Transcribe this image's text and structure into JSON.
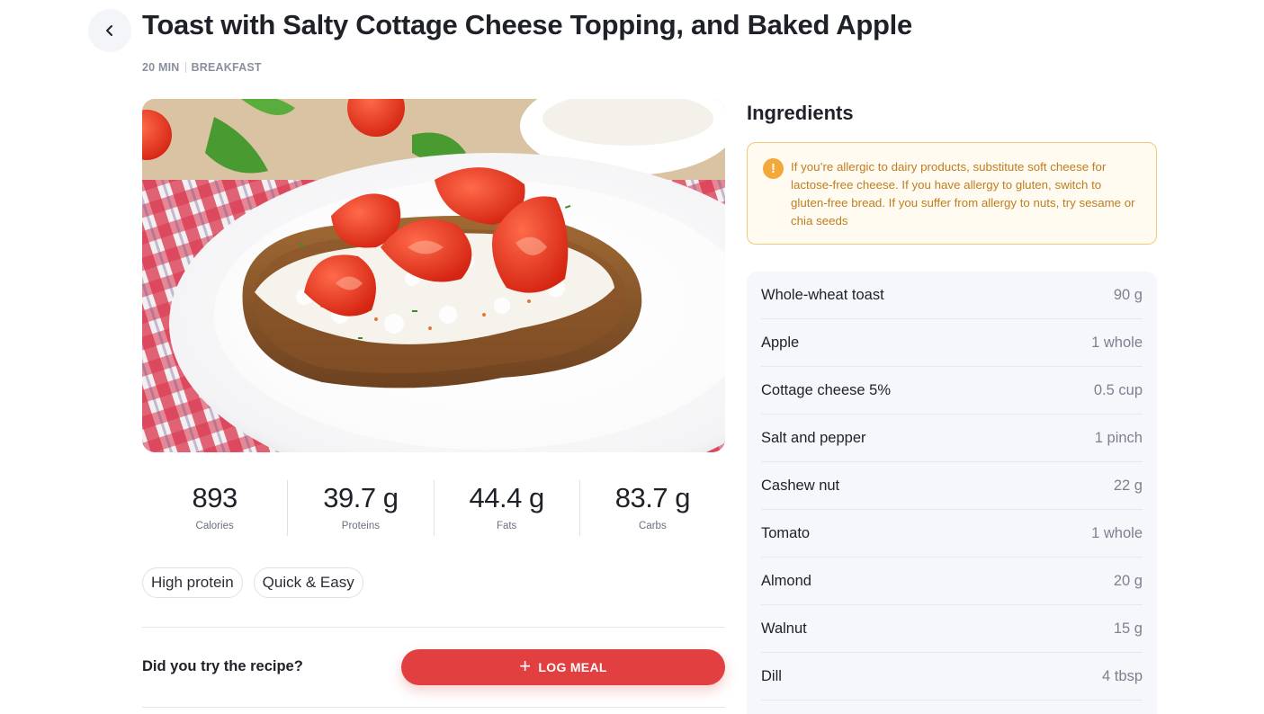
{
  "header": {
    "title": "Toast with Salty Cottage Cheese Topping, and Baked Apple",
    "duration": "20 MIN",
    "meal_type": "BREAKFAST"
  },
  "nutrition": [
    {
      "value": "893",
      "label": "Calories"
    },
    {
      "value": "39.7 g",
      "label": "Proteins"
    },
    {
      "value": "44.4 g",
      "label": "Fats"
    },
    {
      "value": "83.7 g",
      "label": "Carbs"
    }
  ],
  "tags": [
    "High protein",
    "Quick & Easy"
  ],
  "cta": {
    "question": "Did you try the recipe?",
    "log_meal_label": "LOG MEAL"
  },
  "ingredients": {
    "title": "Ingredients",
    "allergy_note": "If you’re allergic to dairy products, substitute soft cheese for lactose-free cheese. If you have allergy to gluten, switch to gluten-free bread. If you suffer from allergy to nuts, try sesame or chia seeds",
    "items": [
      {
        "name": "Whole-wheat toast",
        "qty": "90 g"
      },
      {
        "name": "Apple",
        "qty": "1 whole"
      },
      {
        "name": "Cottage cheese 5%",
        "qty": "0.5 cup"
      },
      {
        "name": "Salt and pepper",
        "qty": "1 pinch"
      },
      {
        "name": "Cashew nut",
        "qty": "22 g"
      },
      {
        "name": "Tomato",
        "qty": "1 whole"
      },
      {
        "name": "Almond",
        "qty": "20 g"
      },
      {
        "name": "Walnut",
        "qty": "15 g"
      },
      {
        "name": "Dill",
        "qty": "4 tbsp"
      }
    ]
  },
  "colors": {
    "accent": "#e13f40",
    "warning_border": "#f2c97a",
    "warning_bg": "#fffbf1",
    "warning_text": "#c07d20"
  }
}
